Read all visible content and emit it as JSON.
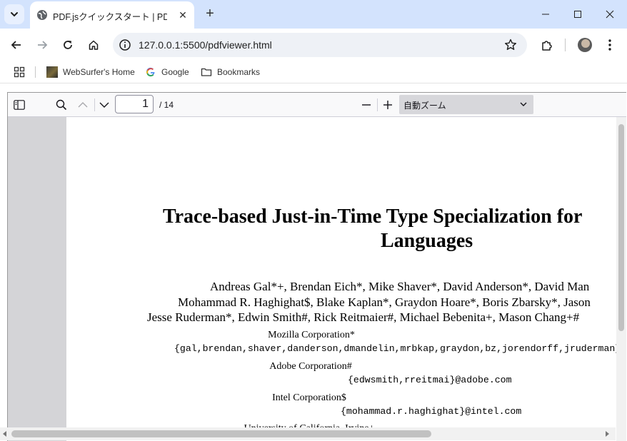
{
  "browser": {
    "tab_title": "PDF.jsクイックスタート | PDFビューワー",
    "url": "127.0.0.1:5500/pdfviewer.html",
    "bookmarks": [
      {
        "label": "WebSurfer's Home",
        "icon": "websurfer-favicon"
      },
      {
        "label": "Google",
        "icon": "google-g-icon"
      },
      {
        "label": "Bookmarks",
        "icon": "folder-icon"
      }
    ]
  },
  "pdf_toolbar": {
    "page_number": "1",
    "page_count": "/ 14",
    "zoom": "自動ズーム"
  },
  "document": {
    "title_line1": "Trace-based Just-in-Time Type Specialization for",
    "title_line2": "Languages",
    "authors_line1": "Andreas Gal*+, Brendan Eich*, Mike Shaver*, David Anderson*, David Man",
    "authors_line2": "Mohammad R. Haghighat$, Blake Kaplan*, Graydon Hoare*, Boris Zbarsky*, Jason",
    "authors_line3": "Jesse Ruderman*, Edwin Smith#, Rick Reitmaier#, Michael Bebenita+, Mason Chang+#",
    "affiliations": [
      {
        "org": "Mozilla Corporation*",
        "email": "{gal,brendan,shaver,danderson,dmandelin,mrbkap,graydon,bz,jorendorff,jruderman}"
      },
      {
        "org": "Adobe Corporation#",
        "email": "{edwsmith,rreitmai}@adobe.com"
      },
      {
        "org": "Intel Corporation$",
        "email": "{mohammad.r.haghighat}@intel.com"
      },
      {
        "org": "University of California, Irvine+",
        "email": ""
      }
    ]
  }
}
